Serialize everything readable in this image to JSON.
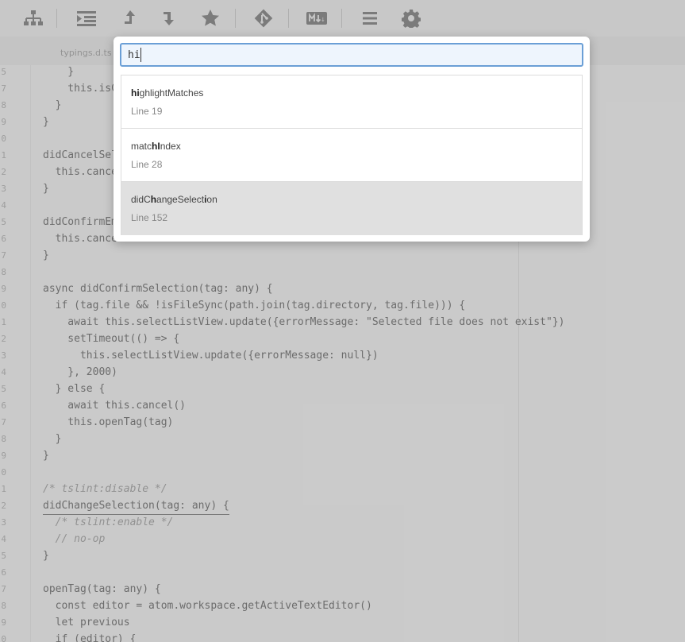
{
  "toolbar": {
    "icons": [
      "tree-view-icon",
      "indent-icon",
      "move-up-icon",
      "move-down-icon",
      "star-icon",
      "git-icon",
      "markdown-icon",
      "menu-icon",
      "settings-icon"
    ]
  },
  "tab": {
    "title": "typings.d.ts"
  },
  "editor": {
    "lines": [
      {
        "n": "5",
        "t": "    }"
      },
      {
        "n": "7",
        "t": "    this.isC"
      },
      {
        "n": "8",
        "t": "  }"
      },
      {
        "n": "9",
        "t": "}"
      },
      {
        "n": "0",
        "t": ""
      },
      {
        "n": "1",
        "t": "didCancelSel"
      },
      {
        "n": "2",
        "t": "  this.cance"
      },
      {
        "n": "3",
        "t": "}"
      },
      {
        "n": "4",
        "t": ""
      },
      {
        "n": "5",
        "t": "didConfirmEm"
      },
      {
        "n": "6",
        "t": "  this.cance"
      },
      {
        "n": "7",
        "t": "}"
      },
      {
        "n": "8",
        "t": ""
      },
      {
        "n": "9",
        "t": "async didConfirmSelection(tag: any) {"
      },
      {
        "n": "0",
        "t": "  if (tag.file && !isFileSync(path.join(tag.directory, tag.file))) {"
      },
      {
        "n": "1",
        "t": "    await this.selectListView.update({errorMessage: \"Selected file does not exist\"})"
      },
      {
        "n": "2",
        "t": "    setTimeout(() => {"
      },
      {
        "n": "3",
        "t": "      this.selectListView.update({errorMessage: null})"
      },
      {
        "n": "4",
        "t": "    }, 2000)"
      },
      {
        "n": "5",
        "t": "  } else {"
      },
      {
        "n": "6",
        "t": "    await this.cancel()"
      },
      {
        "n": "7",
        "t": "    this.openTag(tag)"
      },
      {
        "n": "8",
        "t": "  }"
      },
      {
        "n": "9",
        "t": "}"
      },
      {
        "n": "0",
        "t": ""
      },
      {
        "n": "1",
        "t": "/* tslint:disable */"
      },
      {
        "n": "2",
        "t": "didChangeSelection(tag: any) {"
      },
      {
        "n": "3",
        "t": "  /* tslint:enable */"
      },
      {
        "n": "4",
        "t": "  // no-op"
      },
      {
        "n": "5",
        "t": "}"
      },
      {
        "n": "6",
        "t": ""
      },
      {
        "n": "7",
        "t": "openTag(tag: any) {"
      },
      {
        "n": "8",
        "t": "  const editor = atom.workspace.getActiveTextEditor()"
      },
      {
        "n": "9",
        "t": "  let previous"
      },
      {
        "n": "0",
        "t": "  if (editor) {"
      }
    ]
  },
  "palette": {
    "query": "hi",
    "results": [
      {
        "name_parts": [
          [
            "hi",
            true
          ],
          [
            "ghlightMatches",
            false
          ]
        ],
        "line": "Line 19",
        "selected": false
      },
      {
        "name_parts": [
          [
            "matc",
            false
          ],
          [
            "hI",
            true
          ],
          [
            "ndex",
            false
          ]
        ],
        "line": "Line 28",
        "selected": false
      },
      {
        "name_parts": [
          [
            "didC",
            false
          ],
          [
            "h",
            true
          ],
          [
            "angeSelect",
            false
          ],
          [
            "i",
            true
          ],
          [
            "on",
            false
          ]
        ],
        "line": "Line 152",
        "selected": true
      }
    ]
  },
  "colors": {
    "accent": "#6b9fd6",
    "selected_row": "#e0e0e0"
  }
}
